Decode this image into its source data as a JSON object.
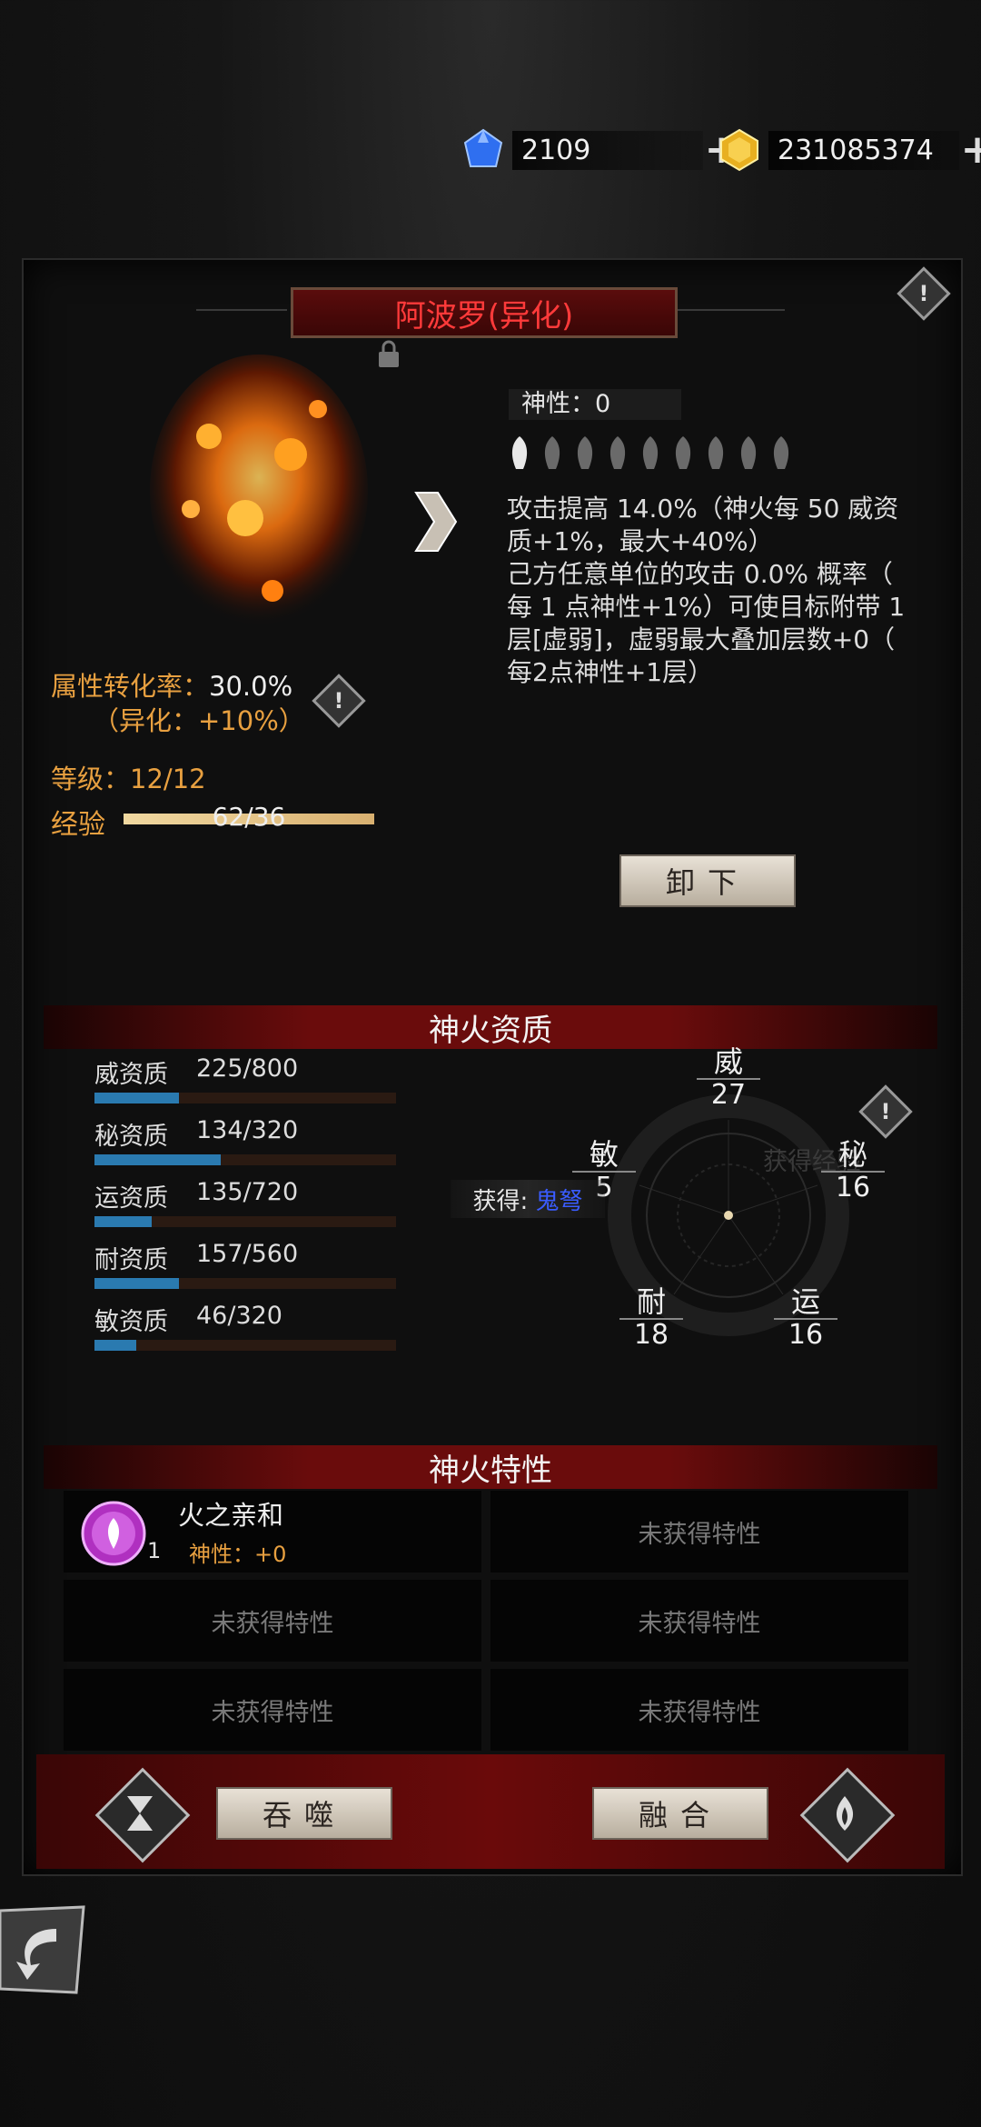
{
  "currency": {
    "gem_value": "2109",
    "gold_value": "231085374"
  },
  "fire": {
    "name": "阿波罗(异化)",
    "divinity_label": "神性：",
    "divinity_value": "0",
    "desc_lines": [
      "攻击提高 14.0%（神火每 50 威资",
      "质+1%，最大+40%）",
      "己方任意单位的攻击 0.0% 概率（",
      "每 1 点神性+1%）可使目标附带 1",
      "层[虚弱]，虚弱最大叠加层数+0（",
      "每2点神性+1层）"
    ],
    "conversion_label": "属性转化率：",
    "conversion_value": "30.0%",
    "conversion_bonus": "（异化：+10%）",
    "level_label": "等级：",
    "level_value": "12/12",
    "exp_label": "经验",
    "exp_text": "62/36",
    "exp_fill": 1.0,
    "unequip_label": "卸下"
  },
  "aptitude": {
    "title": "神火资质",
    "rows": [
      {
        "label": "威资质",
        "value": "225/800",
        "fill": 0.28
      },
      {
        "label": "秘资质",
        "value": "134/320",
        "fill": 0.42
      },
      {
        "label": "运资质",
        "value": "135/720",
        "fill": 0.19
      },
      {
        "label": "耐资质",
        "value": "157/560",
        "fill": 0.28
      },
      {
        "label": "敏资质",
        "value": "46/320",
        "fill": 0.14
      }
    ],
    "stats": {
      "wei": {
        "name": "威",
        "value": "27"
      },
      "mi": {
        "name": "秘",
        "value": "16"
      },
      "yun": {
        "name": "运",
        "value": "16"
      },
      "nai": {
        "name": "耐",
        "value": "18"
      },
      "min": {
        "name": "敏",
        "value": "5"
      }
    },
    "obtain_label": "获得:",
    "obtain_item": "鬼弩",
    "ghost_text": "获得经验"
  },
  "traits": {
    "title": "神火特性",
    "first": {
      "name": "火之亲和",
      "divinity": "神性：+0",
      "count": "1"
    },
    "empty_label": "未获得特性"
  },
  "actions": {
    "devour_label": "吞噬",
    "fuse_label": "融合"
  }
}
